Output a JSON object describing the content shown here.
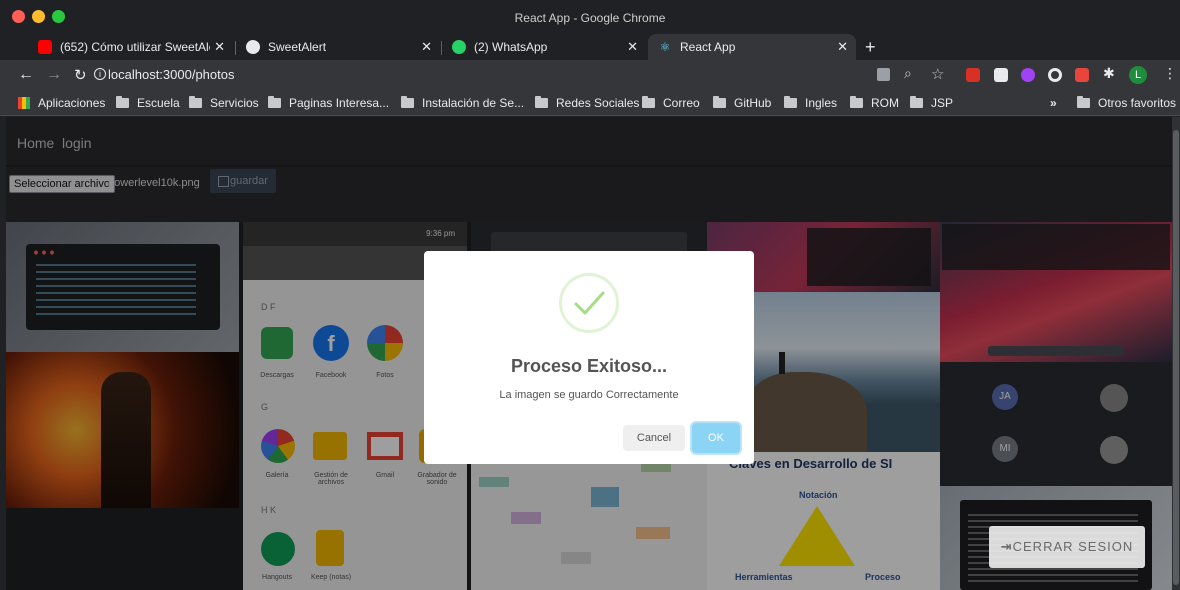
{
  "window": {
    "title": "React App - Google Chrome"
  },
  "tabs": [
    {
      "label": "(652) Cómo utilizar SweetAler",
      "icon": "youtube-icon",
      "color": "#ff0000"
    },
    {
      "label": "SweetAlert",
      "icon": "github-icon",
      "color": "#e8eaed"
    },
    {
      "label": "(2) WhatsApp",
      "icon": "whatsapp-icon",
      "color": "#25d366"
    },
    {
      "label": "React App",
      "icon": "react-icon",
      "color": "#61dafb"
    }
  ],
  "address_bar": {
    "url": "localhost:3000/photos"
  },
  "bookmarks": {
    "apps_label": "Aplicaciones",
    "items": [
      "Escuela",
      "Servicios",
      "Paginas Interesa...",
      "Instalación de Se...",
      "Redes Sociales",
      "Correo",
      "GitHub",
      "Ingles",
      "ROM",
      "JSP"
    ],
    "more": "»",
    "other": "Otros favoritos"
  },
  "navbar": {
    "home": "Home",
    "login": "login"
  },
  "upload": {
    "choose_file": "Seleccionar archivo",
    "file_name": "powerlevel10k.png",
    "save": "guardar"
  },
  "gallery": {
    "phone_time": "9:36 pm",
    "sections": [
      "D F",
      "G",
      "H K"
    ],
    "apps": [
      "Descargas",
      "Facebook",
      "Fotos",
      "Galería",
      "Gestión de archivos",
      "Gmail",
      "Grabador de sonido",
      "Hangouts",
      "Keep (notas)"
    ],
    "slide_title": "Claves en Desarrollo de SI",
    "slide_labels": [
      "Notación",
      "Herramientas",
      "Proceso"
    ],
    "avatars": [
      "JA",
      "MI"
    ]
  },
  "modal": {
    "title": "Proceso Exitoso...",
    "text": "La imagen se guardo Correctamente",
    "cancel": "Cancel",
    "ok": "OK",
    "success_color": "#a5dc86"
  },
  "logout": {
    "label": "CERRAR SESION"
  }
}
